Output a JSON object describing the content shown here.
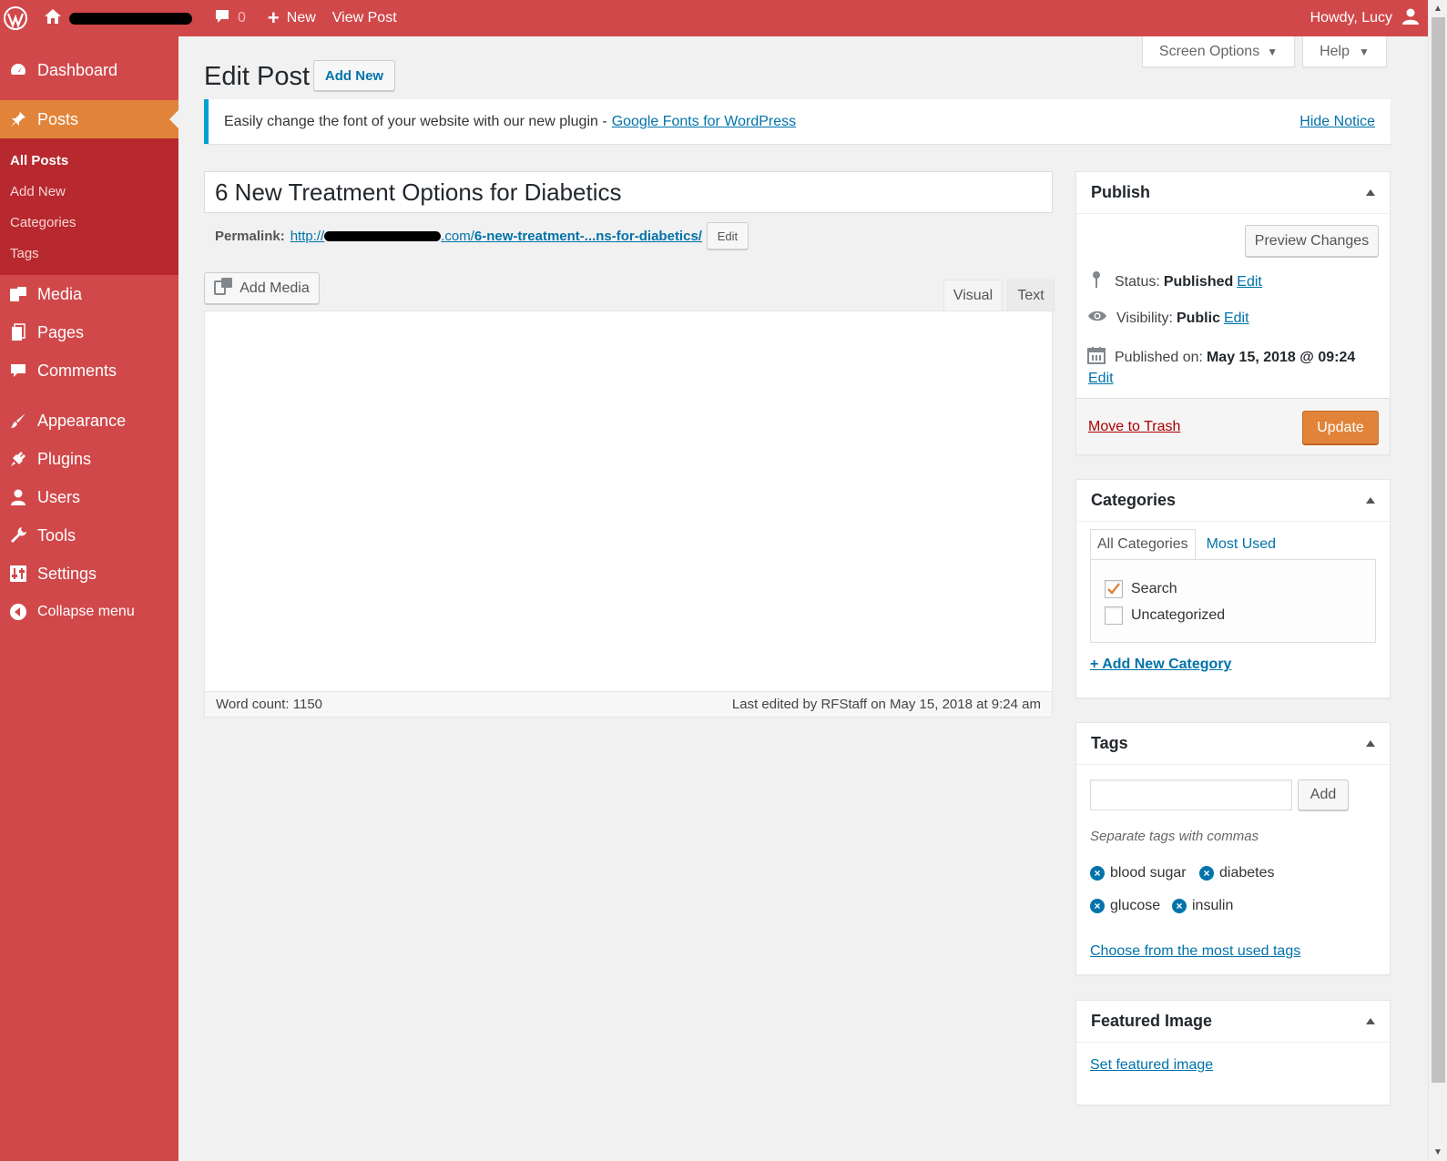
{
  "adminbar": {
    "comments_count": "0",
    "new_label": "New",
    "view_post_label": "View Post",
    "howdy": "Howdy, Lucy"
  },
  "sidebar": {
    "items": [
      {
        "label": "Dashboard",
        "icon": "dashboard-icon"
      },
      {
        "label": "Posts",
        "icon": "pushpin-icon"
      },
      {
        "label": "Media",
        "icon": "media-icon"
      },
      {
        "label": "Pages",
        "icon": "pages-icon"
      },
      {
        "label": "Comments",
        "icon": "comment-icon"
      },
      {
        "label": "Appearance",
        "icon": "paintbrush-icon"
      },
      {
        "label": "Plugins",
        "icon": "plugin-icon"
      },
      {
        "label": "Users",
        "icon": "user-icon"
      },
      {
        "label": "Tools",
        "icon": "wrench-icon"
      },
      {
        "label": "Settings",
        "icon": "settings-icon"
      },
      {
        "label": "Collapse menu",
        "icon": "collapse-icon"
      }
    ],
    "submenu": [
      "All Posts",
      "Add New",
      "Categories",
      "Tags"
    ]
  },
  "header": {
    "title": "Edit Post",
    "add_new": "Add New",
    "screen_options": "Screen Options",
    "help": "Help"
  },
  "notice": {
    "text": "Easily change the font of your website with our new plugin -",
    "link": "Google Fonts for WordPress",
    "hide": "Hide Notice"
  },
  "post": {
    "title": "6 New Treatment Options for Diabetics",
    "permalink_label": "Permalink:",
    "permalink_prefix": "http://",
    "permalink_mid": ".com/",
    "permalink_slug": "6-new-treatment-...ns-for-diabetics/",
    "permalink_edit": "Edit",
    "add_media": "Add Media",
    "tab_visual": "Visual",
    "tab_text": "Text",
    "word_count": "Word count: 1150",
    "last_edited": "Last edited by RFStaff on May 15, 2018 at 9:24 am"
  },
  "publish": {
    "title": "Publish",
    "preview": "Preview Changes",
    "status_label": "Status:",
    "status_value": "Published",
    "visibility_label": "Visibility:",
    "visibility_value": "Public",
    "published_label": "Published on:",
    "published_value": "May 15, 2018 @ 09:24",
    "edit": "Edit",
    "trash": "Move to Trash",
    "update": "Update"
  },
  "categories": {
    "title": "Categories",
    "tab_all": "All Categories",
    "tab_used": "Most Used",
    "items": [
      {
        "label": "Search",
        "checked": true
      },
      {
        "label": "Uncategorized",
        "checked": false
      }
    ],
    "add_new": "+ Add New Category"
  },
  "tags": {
    "title": "Tags",
    "add": "Add",
    "hint": "Separate tags with commas",
    "items": [
      "blood sugar",
      "diabetes",
      "glucose",
      "insulin"
    ],
    "choose": "Choose from the most used tags"
  },
  "featured": {
    "title": "Featured Image",
    "set": "Set featured image"
  },
  "colors": {
    "menu_bg": "#d1484a",
    "menu_current": "#e1843a",
    "submenu_bg": "#b8292f",
    "link": "#0073aa",
    "update_button": "#e1843a"
  }
}
